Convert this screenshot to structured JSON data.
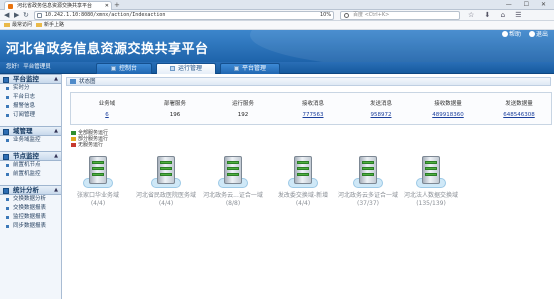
{
  "browser": {
    "tab_title": "河北省政务信息资源交换共享平台",
    "url": "10.242.1.10:8080/xmnx/action/Indexaction",
    "zoom": "10%",
    "search_placeholder": "百度 <Ctrl+K>",
    "bookmarks": [
      "最常访问",
      "新手上路"
    ]
  },
  "app": {
    "title": "河北省政务信息资源交换共享平台",
    "header_links": [
      "帮助",
      "退出"
    ],
    "user": [
      "您好!",
      "平台管理员"
    ],
    "tabs": [
      {
        "label": "控制台",
        "active": false
      },
      {
        "label": "运行管理",
        "active": true
      },
      {
        "label": "平台管理",
        "active": false
      }
    ]
  },
  "sidebar": {
    "sections": [
      {
        "title": "平台监控",
        "items": [
          "实时分",
          "平台日志",
          "报警信息",
          "订阅管理"
        ]
      },
      {
        "title": "域管理",
        "items": [
          "业务域监控"
        ]
      },
      {
        "title": "节点监控",
        "items": [
          "前置机节点",
          "前置机监控"
        ]
      },
      {
        "title": "统计分析",
        "items": [
          "交换数据分析",
          "交换数据报表",
          "监控数据报表",
          "同步数据报表"
        ]
      }
    ]
  },
  "main": {
    "breadcrumb": "状态图",
    "stats": [
      {
        "label": "业务域",
        "value": "6",
        "link": true
      },
      {
        "label": "部署服务",
        "value": "196",
        "link": false
      },
      {
        "label": "运行服务",
        "value": "192",
        "link": false
      },
      {
        "label": "接收消息",
        "value": "777563",
        "link": true
      },
      {
        "label": "发送消息",
        "value": "958972",
        "link": true
      },
      {
        "label": "接收数据量",
        "value": "489918360",
        "link": true
      },
      {
        "label": "发送数据量",
        "value": "648546308",
        "link": true
      }
    ],
    "legend": [
      {
        "label": "全部服务运行",
        "color": "#2f8f2f"
      },
      {
        "label": "部分服务运行",
        "color": "#e0a81f"
      },
      {
        "label": "无服务运行",
        "color": "#c63a2f"
      }
    ],
    "nodes": [
      {
        "name": "张家口华业务域",
        "count": "(4/4)"
      },
      {
        "name": "河北省民政医院医务域",
        "count": "(4/4)"
      },
      {
        "name": "河北政务云...证合一域",
        "count": "(8/8)"
      },
      {
        "name": "发改委交换域-新增",
        "count": "(4/4)"
      },
      {
        "name": "河北政务云多证合一域",
        "count": "(37/37)"
      },
      {
        "name": "河北法人数据交换域",
        "count": "(135/139)"
      }
    ]
  },
  "colors": {
    "header_blue": "#1e63aa",
    "status_green": "#4fae3f"
  }
}
